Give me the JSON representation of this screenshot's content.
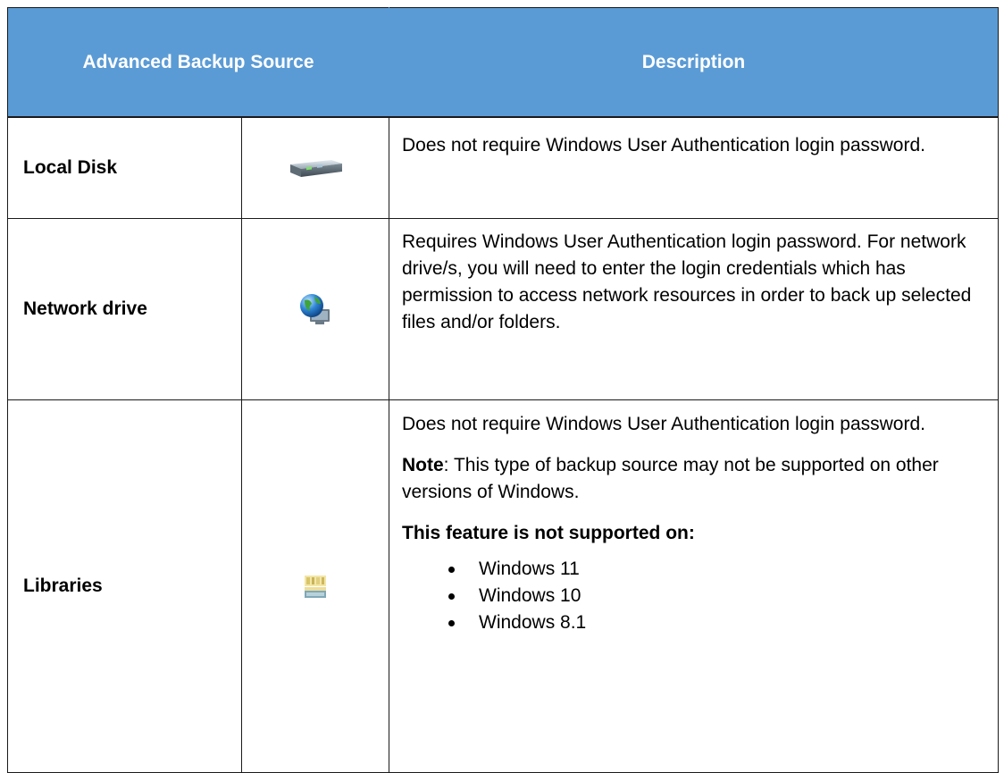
{
  "table": {
    "headers": {
      "source": "Advanced Backup Source",
      "description": "Description"
    },
    "rows": [
      {
        "name": "Local Disk",
        "icon": "local-disk-icon",
        "description": "Does not require Windows User Authentication login password."
      },
      {
        "name": "Network drive",
        "icon": "network-drive-icon",
        "description": "Requires Windows User Authentication login password. For network drive/s, you will need to enter the login credentials which has permission to access network resources in order to back up selected files and/or folders."
      },
      {
        "name": "Libraries",
        "icon": "libraries-icon",
        "description": "Does not require Windows User Authentication login password.",
        "note_label": "Note",
        "note_text": ": This type of backup source may not be supported on other versions of Windows.",
        "unsupported_heading": "This feature is not supported on:",
        "unsupported_list": [
          "Windows 11",
          "Windows 10",
          "Windows 8.1"
        ]
      }
    ]
  },
  "colors": {
    "header_background": "#5b9bd5",
    "header_text": "#ffffff"
  }
}
